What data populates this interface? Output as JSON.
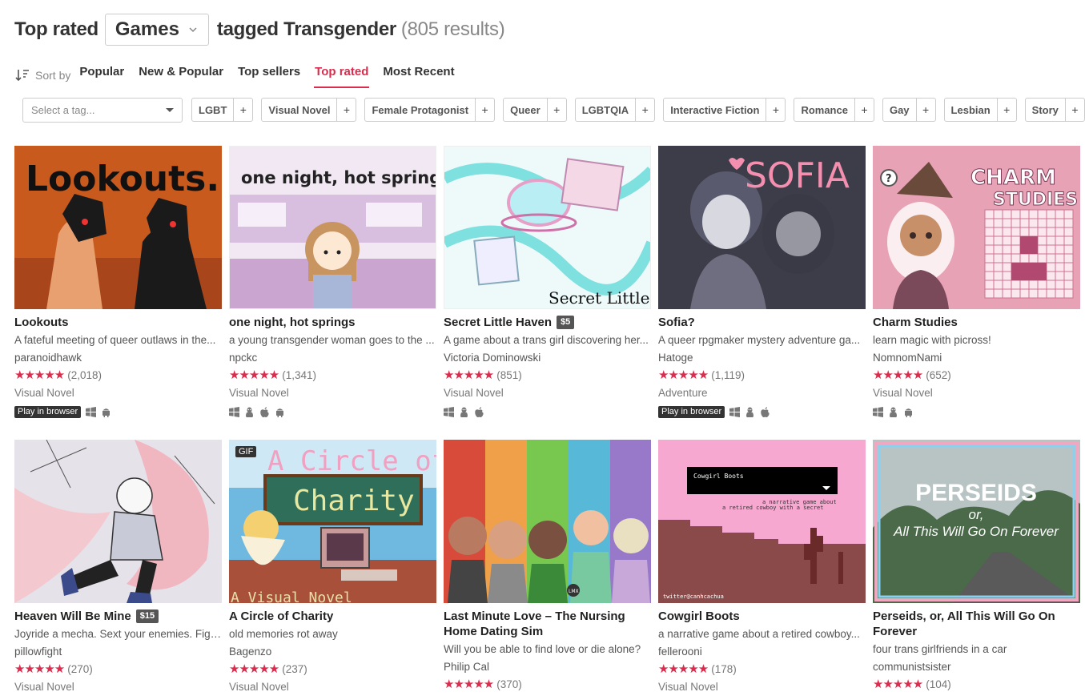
{
  "header": {
    "title": "Top rated",
    "type_select": "Games",
    "tagged": "tagged Transgender",
    "results": "(805 results)"
  },
  "sort": {
    "label": "Sort by",
    "options": [
      "Popular",
      "New & Popular",
      "Top sellers",
      "Top rated",
      "Most Recent"
    ],
    "active": "Top rated"
  },
  "tags": {
    "placeholder": "Select a tag...",
    "chips": [
      "LGBT",
      "Visual Novel",
      "Female Protagonist",
      "Queer",
      "LGBTQIA",
      "Interactive Fiction",
      "Romance",
      "Gay",
      "Lesbian",
      "Story"
    ]
  },
  "accent_color": "#da2c4d",
  "games": [
    {
      "title": "Lookouts",
      "price": "",
      "desc": "A fateful meeting of queer outlaws in the...",
      "author": "paranoidhawk",
      "rating": 5,
      "count": "(2,018)",
      "genre": "Visual Novel",
      "play_in_browser": "Play in browser",
      "platforms": [
        "windows-icon",
        "android-icon"
      ]
    },
    {
      "title": "one night, hot springs",
      "price": "",
      "desc": "a young transgender woman goes to the ...",
      "author": "npckc",
      "rating": 5,
      "count": "(1,341)",
      "genre": "Visual Novel",
      "play_in_browser": "",
      "platforms": [
        "windows-icon",
        "linux-icon",
        "apple-icon",
        "android-icon"
      ]
    },
    {
      "title": "Secret Little Haven",
      "price": "$5",
      "desc": "A game about a trans girl discovering her...",
      "author": "Victoria Dominowski",
      "rating": 5,
      "count": "(851)",
      "genre": "Visual Novel",
      "play_in_browser": "",
      "platforms": [
        "windows-icon",
        "linux-icon",
        "apple-icon"
      ]
    },
    {
      "title": "Sofia?",
      "price": "",
      "desc": "A queer rpgmaker mystery adventure ga...",
      "author": "Hatoge",
      "rating": 5,
      "count": "(1,119)",
      "genre": "Adventure",
      "play_in_browser": "Play in browser",
      "platforms": [
        "windows-icon",
        "linux-icon",
        "apple-icon"
      ]
    },
    {
      "title": "Charm Studies",
      "price": "",
      "desc": "learn magic with picross!",
      "author": "NomnomNami",
      "rating": 5,
      "count": "(652)",
      "genre": "Visual Novel",
      "play_in_browser": "",
      "platforms": [
        "windows-icon",
        "linux-icon",
        "android-icon"
      ]
    },
    {
      "title": "Heaven Will Be Mine",
      "price": "$15",
      "desc": "Joyride a mecha. Sext your enemies. Figh...",
      "author": "pillowfight",
      "rating": 5,
      "count": "(270)",
      "genre": "Visual Novel"
    },
    {
      "title": "A Circle of Charity",
      "price": "",
      "desc": "old memories rot away",
      "author": "Bagenzo",
      "rating": 5,
      "count": "(237)",
      "genre": "Visual Novel",
      "gif": "GIF"
    },
    {
      "title": "Last Minute Love – The Nursing Home Dating Sim",
      "price": "",
      "desc": "Will you be able to find love or die alone?",
      "author": "Philip Cal",
      "rating": 5,
      "count": "(370)",
      "genre": ""
    },
    {
      "title": "Cowgirl Boots",
      "price": "",
      "desc": "a narrative game about a retired cowboy...",
      "author": "fellerooni",
      "rating": 5,
      "count": "(178)",
      "genre": "Visual Novel"
    },
    {
      "title": "Perseids, or, All This Will Go On Forever",
      "price": "",
      "desc": "four trans girlfriends in a car",
      "author": "communistsister",
      "rating": 5,
      "count": "(104)",
      "genre": ""
    }
  ],
  "thumb_text": {
    "lookouts": "Lookouts.",
    "hotsprings": "one night, hot springs",
    "haven": "Secret Little Haven",
    "sofia": "SOFIA",
    "charm1": "CHARM",
    "charm2": "STUDIES",
    "circle1": "A Circle of",
    "circle2": "Charity",
    "circle3": "A Visual Novel",
    "cowgirl_box": "Cowgirl Boots",
    "cowgirl_sub1": "a narrative game about",
    "cowgirl_sub2": "a retired cowboy with a secret",
    "cowgirl_credit": "twitter@canhcachua",
    "perseids1": "PERSEIDS",
    "perseids2": "or,",
    "perseids3": "All This Will Go On Forever",
    "lml_badge": "LMX"
  }
}
